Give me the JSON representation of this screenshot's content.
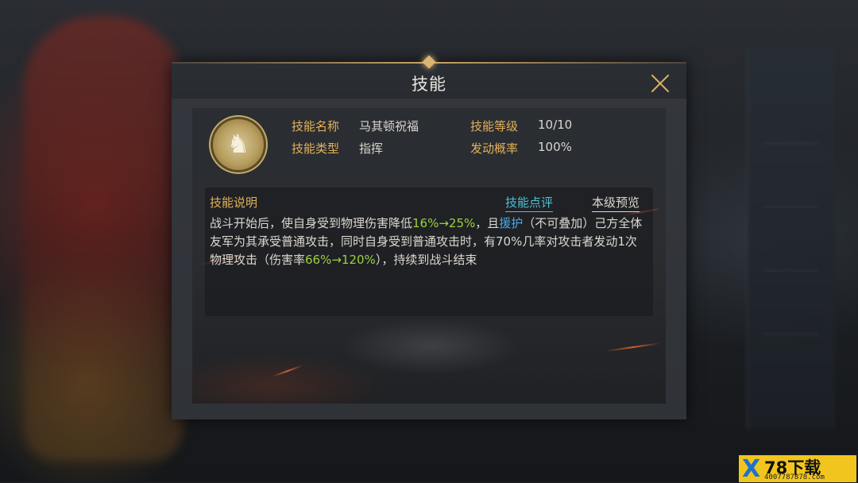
{
  "dialog": {
    "title": "技能",
    "close_icon": "close-x-icon"
  },
  "skill": {
    "icon": "cavalry-charge-skill-icon",
    "name_label": "技能名称",
    "name_value": "马其顿祝福",
    "level_label": "技能等级",
    "level_value": "10/10",
    "type_label": "技能类型",
    "type_value": "指挥",
    "chance_label": "发动概率",
    "chance_value": "100%"
  },
  "description": {
    "title": "技能说明",
    "review_link": "技能点评",
    "preview_link": "本级预览",
    "segments": [
      {
        "text": "战斗开始后，使自身受到物理伤害降低",
        "style": "normal"
      },
      {
        "text": "16%→25%",
        "style": "green"
      },
      {
        "text": "，且",
        "style": "normal"
      },
      {
        "text": "援护",
        "style": "blue"
      },
      {
        "text": "（不可叠加）己方全体友军为其承受普通攻击，同时自身受到普通攻击时，有70%几率对攻击者发动1次物理攻击（伤害率",
        "style": "normal"
      },
      {
        "text": "66%→120%",
        "style": "green"
      },
      {
        "text": "），持续到战斗结束",
        "style": "normal"
      }
    ]
  },
  "colors": {
    "label_gold": "#e2b25a",
    "highlight_green": "#9bd23c",
    "highlight_blue": "#4aa8e8",
    "link_cyan": "#4fc0d6"
  },
  "watermark": {
    "logo_letter": "X",
    "name": "78下载",
    "url": "4007787878.com"
  }
}
